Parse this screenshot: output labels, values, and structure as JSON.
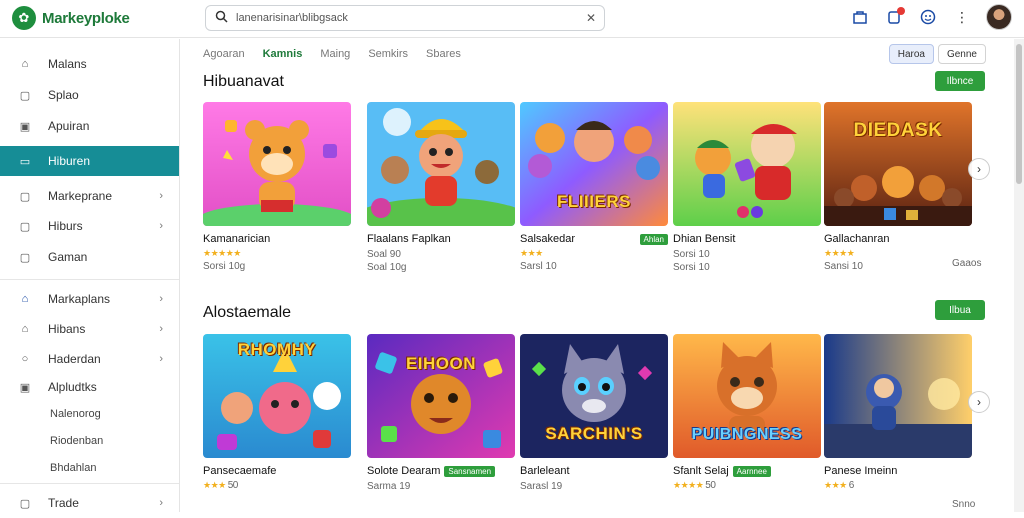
{
  "app": {
    "name": "Markeyploke"
  },
  "search": {
    "text": "lanenarisinar\\blibgsack"
  },
  "sidebar": {
    "items": [
      {
        "label": "Malans",
        "icon": "home-icon"
      },
      {
        "label": "Splao",
        "icon": "square-icon"
      },
      {
        "label": "Apuiran",
        "icon": "grid-icon"
      },
      {
        "label": "Hiburen",
        "icon": "folder-icon",
        "active": true
      },
      {
        "label": "Markeprane",
        "icon": "bag-icon"
      },
      {
        "label": "Hiburs",
        "icon": "box-icon"
      },
      {
        "label": "Gaman",
        "icon": "clipboard-icon"
      },
      {
        "label": "Markaplans",
        "icon": "home-icon"
      },
      {
        "label": "Hibans",
        "icon": "cart-icon"
      },
      {
        "label": "Haderdan",
        "icon": "circle-icon"
      },
      {
        "label": "Alpludtks",
        "icon": "page-icon"
      }
    ],
    "sub": [
      "Nalenorog",
      "Riodenban",
      "Bhdahlan"
    ],
    "bottom": {
      "label": "Trade",
      "icon": "square-icon"
    }
  },
  "tabs": [
    "Agoaran",
    "Kamnis",
    "Maing",
    "Semkirs",
    "Sbares"
  ],
  "active_tab": "Kamnis",
  "segments": [
    "Haroa",
    "Genne"
  ],
  "sections": [
    {
      "title": "Hibuanavat",
      "button": "Ilbnce",
      "cards": [
        {
          "name": "Kamanarician",
          "stars": "★★★★★",
          "meta": "Sorsi 10g",
          "thumb_text": "",
          "bg": "#f06ad9"
        },
        {
          "name": "Flaalans Faplkan",
          "stars": "",
          "meta": "Soal 90",
          "meta2": "Soal 10g",
          "thumb_text": "",
          "bg": "#4fb6ff"
        },
        {
          "name": "Salsakedar",
          "badge": "Ahlan",
          "stars": "★★★",
          "meta": "Sarsl 10",
          "thumb_text": "FLIIIERS",
          "bg": "#7d5cff"
        },
        {
          "name": "Dhian Bensit",
          "stars": "",
          "meta": "Sorsi 10",
          "meta2": "Sorsi 10",
          "thumb_text": "",
          "bg": "#5ecf6a"
        },
        {
          "name": "Gallachanran",
          "stars": "★★★★",
          "meta": "Sansi 10",
          "thumb_text": "DIEDASK",
          "bg": "#c0481e"
        }
      ],
      "right_meta": "Gaaos"
    },
    {
      "title": "Alostaemale",
      "button": "Ilbua",
      "cards": [
        {
          "name": "Pansecaemafe",
          "stars": "★★★",
          "meta": "50",
          "thumb_text": "RHOMHY",
          "bg": "#35b4d8"
        },
        {
          "name": "Solote Dearam",
          "badge": "Sansnamen",
          "stars": "",
          "meta": "Sarma 19",
          "thumb_text": "EIHOON",
          "bg": "#a93ac0"
        },
        {
          "name": "Barleleant",
          "stars": "",
          "meta": "Sarasl 19",
          "thumb_text": "SARCHIN'S",
          "bg": "#27306e"
        },
        {
          "name": "Sfanlt Selaj",
          "badge": "Aarnnee",
          "stars": "★★★★",
          "meta": "50",
          "thumb_text": "PUIBNGNESS",
          "bg": "#f08a2c"
        },
        {
          "name": "Panese Imeinn",
          "stars": "★★★",
          "meta": "6",
          "thumb_text": "",
          "bg": "#1f5fb0"
        }
      ],
      "right_meta": "Snno"
    }
  ],
  "colors": {
    "accent": "#168d96",
    "brand_green": "#2e9e3c"
  }
}
